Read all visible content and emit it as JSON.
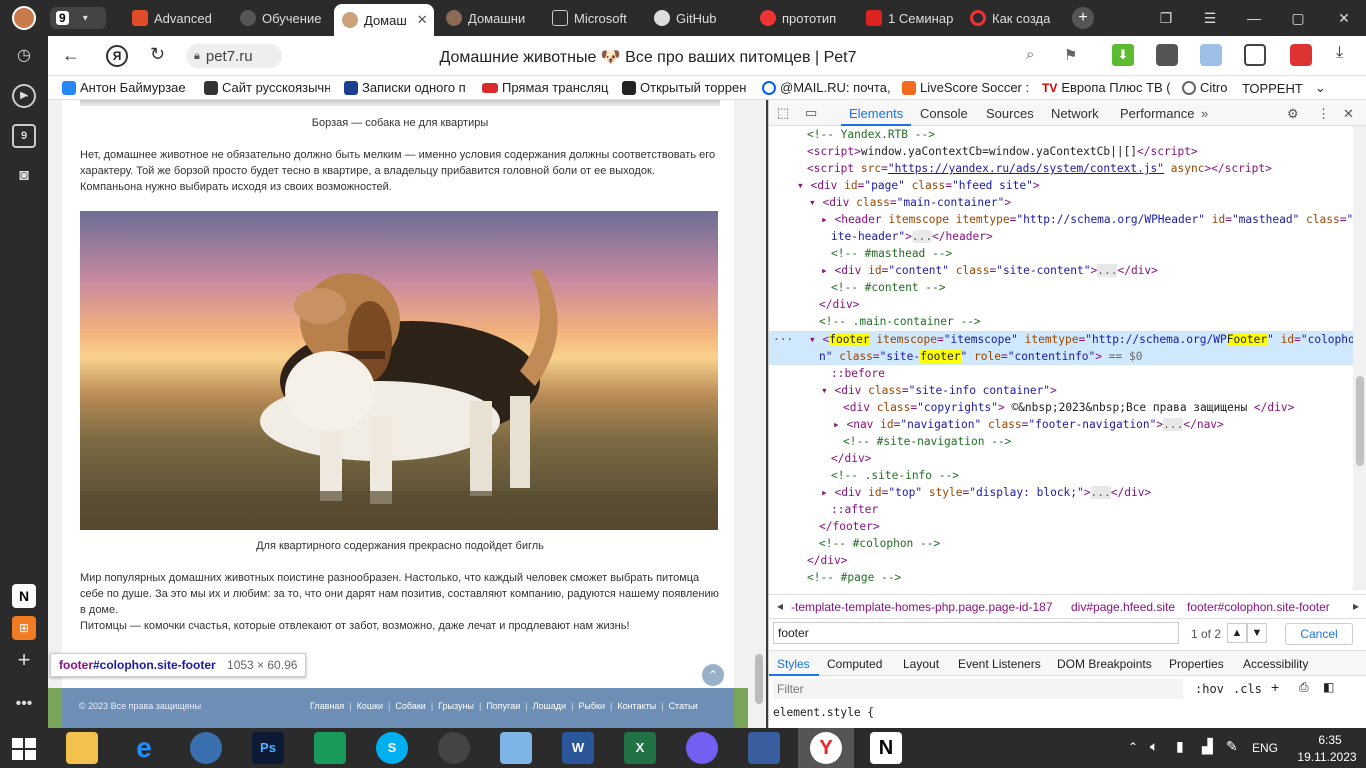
{
  "tabs": {
    "count_badge": "9",
    "items": [
      {
        "label": "Advanced"
      },
      {
        "label": "Обучение"
      },
      {
        "label": "Домаш"
      },
      {
        "label": "Домашни"
      },
      {
        "label": "Microsoft"
      },
      {
        "label": "GitHub"
      },
      {
        "label": "прототип"
      },
      {
        "label": "1 Семинар"
      },
      {
        "label": "Как созда"
      }
    ],
    "new_tab": "+"
  },
  "address": {
    "url": "pet7.ru",
    "title": "Домашние животные 🐶 Все про ваших питомцев | Pet7",
    "ya_label": "Я"
  },
  "bookmarks": [
    {
      "label": "Антон Баймурзае",
      "color": "#2787f5"
    },
    {
      "label": "Сайт русскоязычн",
      "color": "#333333"
    },
    {
      "label": "Записки одного п",
      "color": "#1d3f8f"
    },
    {
      "label": "Прямая трансляц",
      "color": "#d92b2b"
    },
    {
      "label": "Открытый торрен",
      "color": "#222222"
    },
    {
      "label": "@MAIL.RU: почта,",
      "color": "#005ff9"
    },
    {
      "label": "LiveScore Soccer :",
      "color": "#f26b21"
    },
    {
      "label": "Европа Плюс ТВ (",
      "color": "#cc0000"
    },
    {
      "label": "Citro",
      "color": "#666666"
    },
    {
      "label": "ТОРРЕНТ",
      "color": "#222222"
    }
  ],
  "article": {
    "caption1": "Борзая — собака не для квартиры",
    "para1": "Нет, домашнее животное не обязательно должно быть мелким — именно условия содержания должны соответствовать его характеру. Той же борзой просто будет тесно в квартире, а владельцу прибавится головной боли от ее выходок. Компаньона нужно выбирать исходя из своих возможностей.",
    "caption2": "Для квартирного содержания прекрасно подойдет бигль",
    "para2": "Мир популярных домашних животных поистине разнообразен. Настолько, что каждый человек сможет выбрать питомца себе по душе. За это мы их и любим: за то, что они дарят нам позитив, составляют компанию, радуются нашему появлению в доме.",
    "para3": "Питомцы — комочки счастья, которые отвлекают от забот, возможно, даже лечат и продлевают нам жизнь!"
  },
  "tooltip": {
    "tag": "footer",
    "selector": "#colophon.site-footer",
    "size": "1053 × 60.96"
  },
  "footer": {
    "copyright": "© 2023 Все права защищены",
    "links": [
      "Главная",
      "Кошки",
      "Собаки",
      "Грызуны",
      "Попугаи",
      "Лошади",
      "Рыбки",
      "Контакты",
      "Статьи"
    ]
  },
  "devtools": {
    "tabs": [
      "Elements",
      "Console",
      "Sources",
      "Network",
      "Performance"
    ],
    "active_tab": "Elements",
    "breadcrumbs": [
      "-template-template-homes-php.page.page-id-187",
      "div#page.hfeed.site",
      "footer#colophon.site-footer"
    ],
    "search_value": "footer",
    "search_count": "1 of 2",
    "cancel_label": "Cancel",
    "style_tabs": [
      "Styles",
      "Computed",
      "Layout",
      "Event Listeners",
      "DOM Breakpoints",
      "Properties",
      "Accessibility"
    ],
    "filter_placeholder": "Filter",
    "hov": ":hov",
    "cls": ".cls",
    "element_style": "element.style {",
    "dots": "...",
    "eq_dollar": "== $0"
  },
  "clock": {
    "time": "6:35",
    "date": "19.11.2023",
    "lang": "ENG"
  },
  "colors": {
    "accent": "#1a73e8",
    "footer_bg": "#6d8fb5",
    "selected_node": "#cfe8fc"
  }
}
